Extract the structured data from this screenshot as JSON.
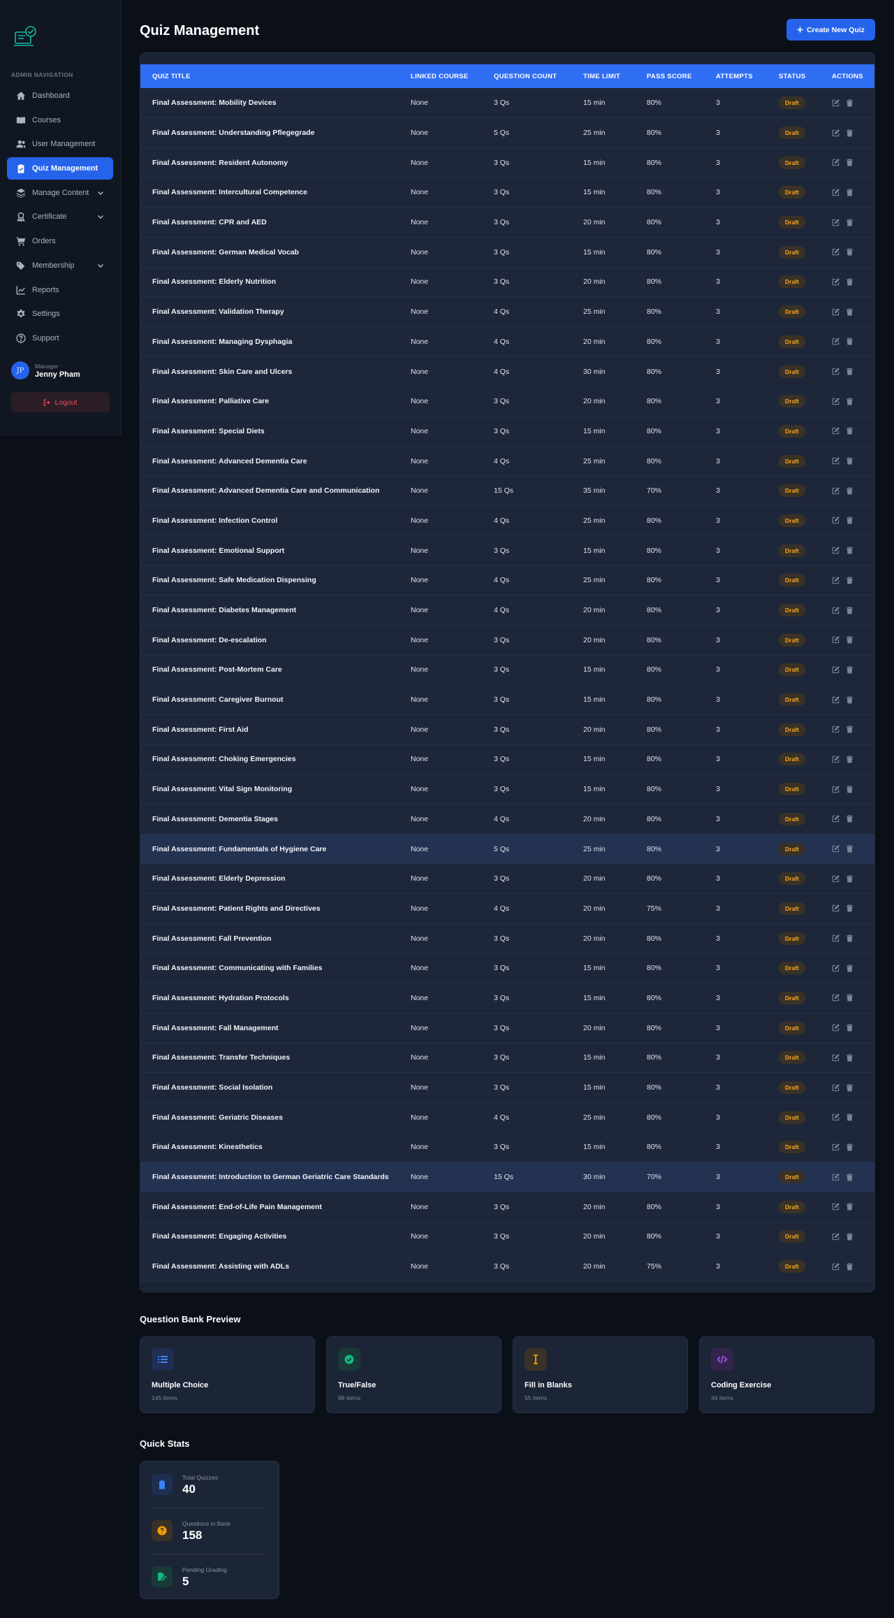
{
  "sidebar": {
    "section_label": "ADMIN NAVIGATION",
    "items": [
      {
        "label": "Dashboard",
        "icon": "home-icon"
      },
      {
        "label": "Courses",
        "icon": "book-icon"
      },
      {
        "label": "User Management",
        "icon": "users-icon"
      },
      {
        "label": "Quiz Management",
        "icon": "clipboard-check-icon",
        "active": true
      },
      {
        "label": "Manage Content",
        "icon": "layers-icon",
        "has_submenu": true
      },
      {
        "label": "Certificate",
        "icon": "award-icon",
        "has_submenu": true
      },
      {
        "label": "Orders",
        "icon": "cart-icon"
      },
      {
        "label": "Membership",
        "icon": "tags-icon",
        "has_submenu": true
      },
      {
        "label": "Reports",
        "icon": "chart-line-icon"
      },
      {
        "label": "Settings",
        "icon": "gear-icon"
      },
      {
        "label": "Support",
        "icon": "question-circle-icon"
      }
    ],
    "user": {
      "initials": "JP",
      "role": "Manager",
      "name": "Jenny Pham"
    },
    "logout_label": "Logout"
  },
  "header": {
    "title": "Quiz Management",
    "create_button": "Create New Quiz"
  },
  "table": {
    "columns": [
      "QUIZ TITLE",
      "LINKED COURSE",
      "QUESTION COUNT",
      "TIME LIMIT",
      "PASS SCORE",
      "ATTEMPTS",
      "STATUS",
      "ACTIONS"
    ],
    "rows": [
      {
        "title": "Final Assessment: Mobility Devices",
        "course": "None",
        "questions": "3 Qs",
        "time": "15 min",
        "pass": "80%",
        "attempts": "3",
        "status": "Draft"
      },
      {
        "title": "Final Assessment: Understanding Pflegegrade",
        "course": "None",
        "questions": "5 Qs",
        "time": "25 min",
        "pass": "80%",
        "attempts": "3",
        "status": "Draft"
      },
      {
        "title": "Final Assessment: Resident Autonomy",
        "course": "None",
        "questions": "3 Qs",
        "time": "15 min",
        "pass": "80%",
        "attempts": "3",
        "status": "Draft"
      },
      {
        "title": "Final Assessment: Intercultural Competence",
        "course": "None",
        "questions": "3 Qs",
        "time": "15 min",
        "pass": "80%",
        "attempts": "3",
        "status": "Draft"
      },
      {
        "title": "Final Assessment: CPR and AED",
        "course": "None",
        "questions": "3 Qs",
        "time": "20 min",
        "pass": "80%",
        "attempts": "3",
        "status": "Draft"
      },
      {
        "title": "Final Assessment: German Medical Vocab",
        "course": "None",
        "questions": "3 Qs",
        "time": "15 min",
        "pass": "80%",
        "attempts": "3",
        "status": "Draft"
      },
      {
        "title": "Final Assessment: Elderly Nutrition",
        "course": "None",
        "questions": "3 Qs",
        "time": "20 min",
        "pass": "80%",
        "attempts": "3",
        "status": "Draft"
      },
      {
        "title": "Final Assessment: Validation Therapy",
        "course": "None",
        "questions": "4 Qs",
        "time": "25 min",
        "pass": "80%",
        "attempts": "3",
        "status": "Draft"
      },
      {
        "title": "Final Assessment: Managing Dysphagia",
        "course": "None",
        "questions": "4 Qs",
        "time": "20 min",
        "pass": "80%",
        "attempts": "3",
        "status": "Draft"
      },
      {
        "title": "Final Assessment: Skin Care and Ulcers",
        "course": "None",
        "questions": "4 Qs",
        "time": "30 min",
        "pass": "80%",
        "attempts": "3",
        "status": "Draft"
      },
      {
        "title": "Final Assessment: Palliative Care",
        "course": "None",
        "questions": "3 Qs",
        "time": "20 min",
        "pass": "80%",
        "attempts": "3",
        "status": "Draft"
      },
      {
        "title": "Final Assessment: Special Diets",
        "course": "None",
        "questions": "3 Qs",
        "time": "15 min",
        "pass": "80%",
        "attempts": "3",
        "status": "Draft"
      },
      {
        "title": "Final Assessment: Advanced Dementia Care",
        "course": "None",
        "questions": "4 Qs",
        "time": "25 min",
        "pass": "80%",
        "attempts": "3",
        "status": "Draft"
      },
      {
        "title": "Final Assessment: Advanced Dementia Care and Communication",
        "course": "None",
        "questions": "15 Qs",
        "time": "35 min",
        "pass": "70%",
        "attempts": "3",
        "status": "Draft"
      },
      {
        "title": "Final Assessment: Infection Control",
        "course": "None",
        "questions": "4 Qs",
        "time": "25 min",
        "pass": "80%",
        "attempts": "3",
        "status": "Draft"
      },
      {
        "title": "Final Assessment: Emotional Support",
        "course": "None",
        "questions": "3 Qs",
        "time": "15 min",
        "pass": "80%",
        "attempts": "3",
        "status": "Draft"
      },
      {
        "title": "Final Assessment: Safe Medication Dispensing",
        "course": "None",
        "questions": "4 Qs",
        "time": "25 min",
        "pass": "80%",
        "attempts": "3",
        "status": "Draft"
      },
      {
        "title": "Final Assessment: Diabetes Management",
        "course": "None",
        "questions": "4 Qs",
        "time": "20 min",
        "pass": "80%",
        "attempts": "3",
        "status": "Draft"
      },
      {
        "title": "Final Assessment: De-escalation",
        "course": "None",
        "questions": "3 Qs",
        "time": "20 min",
        "pass": "80%",
        "attempts": "3",
        "status": "Draft"
      },
      {
        "title": "Final Assessment: Post-Mortem Care",
        "course": "None",
        "questions": "3 Qs",
        "time": "15 min",
        "pass": "80%",
        "attempts": "3",
        "status": "Draft"
      },
      {
        "title": "Final Assessment: Caregiver Burnout",
        "course": "None",
        "questions": "3 Qs",
        "time": "15 min",
        "pass": "80%",
        "attempts": "3",
        "status": "Draft"
      },
      {
        "title": "Final Assessment: First Aid",
        "course": "None",
        "questions": "3 Qs",
        "time": "20 min",
        "pass": "80%",
        "attempts": "3",
        "status": "Draft"
      },
      {
        "title": "Final Assessment: Choking Emergencies",
        "course": "None",
        "questions": "3 Qs",
        "time": "15 min",
        "pass": "80%",
        "attempts": "3",
        "status": "Draft"
      },
      {
        "title": "Final Assessment: Vital Sign Monitoring",
        "course": "None",
        "questions": "3 Qs",
        "time": "15 min",
        "pass": "80%",
        "attempts": "3",
        "status": "Draft"
      },
      {
        "title": "Final Assessment: Dementia Stages",
        "course": "None",
        "questions": "4 Qs",
        "time": "20 min",
        "pass": "80%",
        "attempts": "3",
        "status": "Draft"
      },
      {
        "title": "Final Assessment: Fundamentals of Hygiene Care",
        "course": "None",
        "questions": "5 Qs",
        "time": "25 min",
        "pass": "80%",
        "attempts": "3",
        "status": "Draft",
        "highlight": true
      },
      {
        "title": "Final Assessment: Elderly Depression",
        "course": "None",
        "questions": "3 Qs",
        "time": "20 min",
        "pass": "80%",
        "attempts": "3",
        "status": "Draft"
      },
      {
        "title": "Final Assessment: Patient Rights and Directives",
        "course": "None",
        "questions": "4 Qs",
        "time": "20 min",
        "pass": "75%",
        "attempts": "3",
        "status": "Draft"
      },
      {
        "title": "Final Assessment: Fall Prevention",
        "course": "None",
        "questions": "3 Qs",
        "time": "20 min",
        "pass": "80%",
        "attempts": "3",
        "status": "Draft"
      },
      {
        "title": "Final Assessment: Communicating with Families",
        "course": "None",
        "questions": "3 Qs",
        "time": "15 min",
        "pass": "80%",
        "attempts": "3",
        "status": "Draft"
      },
      {
        "title": "Final Assessment: Hydration Protocols",
        "course": "None",
        "questions": "3 Qs",
        "time": "15 min",
        "pass": "80%",
        "attempts": "3",
        "status": "Draft"
      },
      {
        "title": "Final Assessment: Fall Management",
        "course": "None",
        "questions": "3 Qs",
        "time": "20 min",
        "pass": "80%",
        "attempts": "3",
        "status": "Draft"
      },
      {
        "title": "Final Assessment: Transfer Techniques",
        "course": "None",
        "questions": "3 Qs",
        "time": "15 min",
        "pass": "80%",
        "attempts": "3",
        "status": "Draft"
      },
      {
        "title": "Final Assessment: Social Isolation",
        "course": "None",
        "questions": "3 Qs",
        "time": "15 min",
        "pass": "80%",
        "attempts": "3",
        "status": "Draft"
      },
      {
        "title": "Final Assessment: Geriatric Diseases",
        "course": "None",
        "questions": "4 Qs",
        "time": "25 min",
        "pass": "80%",
        "attempts": "3",
        "status": "Draft"
      },
      {
        "title": "Final Assessment: Kinesthetics",
        "course": "None",
        "questions": "3 Qs",
        "time": "15 min",
        "pass": "80%",
        "attempts": "3",
        "status": "Draft"
      },
      {
        "title": "Final Assessment: Introduction to German Geriatric Care Standards",
        "course": "None",
        "questions": "15 Qs",
        "time": "30 min",
        "pass": "70%",
        "attempts": "3",
        "status": "Draft",
        "highlight": true
      },
      {
        "title": "Final Assessment: End-of-Life Pain Management",
        "course": "None",
        "questions": "3 Qs",
        "time": "20 min",
        "pass": "80%",
        "attempts": "3",
        "status": "Draft"
      },
      {
        "title": "Final Assessment: Engaging Activities",
        "course": "None",
        "questions": "3 Qs",
        "time": "20 min",
        "pass": "80%",
        "attempts": "3",
        "status": "Draft"
      },
      {
        "title": "Final Assessment: Assisting with ADLs",
        "course": "None",
        "questions": "3 Qs",
        "time": "20 min",
        "pass": "75%",
        "attempts": "3",
        "status": "Draft"
      }
    ]
  },
  "question_bank": {
    "title": "Question Bank Preview",
    "cards": [
      {
        "name": "Multiple Choice",
        "count": "145 items",
        "icon": "list-icon",
        "color": "#3b82f6",
        "bg": "#1f2f52"
      },
      {
        "name": "True/False",
        "count": "68 items",
        "icon": "check-circle-icon",
        "color": "#10b981",
        "bg": "#193a37"
      },
      {
        "name": "Fill in Blanks",
        "count": "55 items",
        "icon": "text-cursor-icon",
        "color": "#f59e0b",
        "bg": "#3a3226"
      },
      {
        "name": "Coding Exercise",
        "count": "44 items",
        "icon": "code-icon",
        "color": "#a855f7",
        "bg": "#33244d"
      }
    ]
  },
  "quick_stats": {
    "title": "Quick Stats",
    "items": [
      {
        "label": "Total Quizzes",
        "value": "40",
        "icon": "clipboard-icon",
        "color": "#3b82f6",
        "bg": "#1f2f52"
      },
      {
        "label": "Questions in Bank",
        "value": "158",
        "icon": "question-icon",
        "color": "#f59e0b",
        "bg": "#3a3226"
      },
      {
        "label": "Pending Grading",
        "value": "5",
        "icon": "file-signature-icon",
        "color": "#10b981",
        "bg": "#193a37"
      }
    ]
  }
}
